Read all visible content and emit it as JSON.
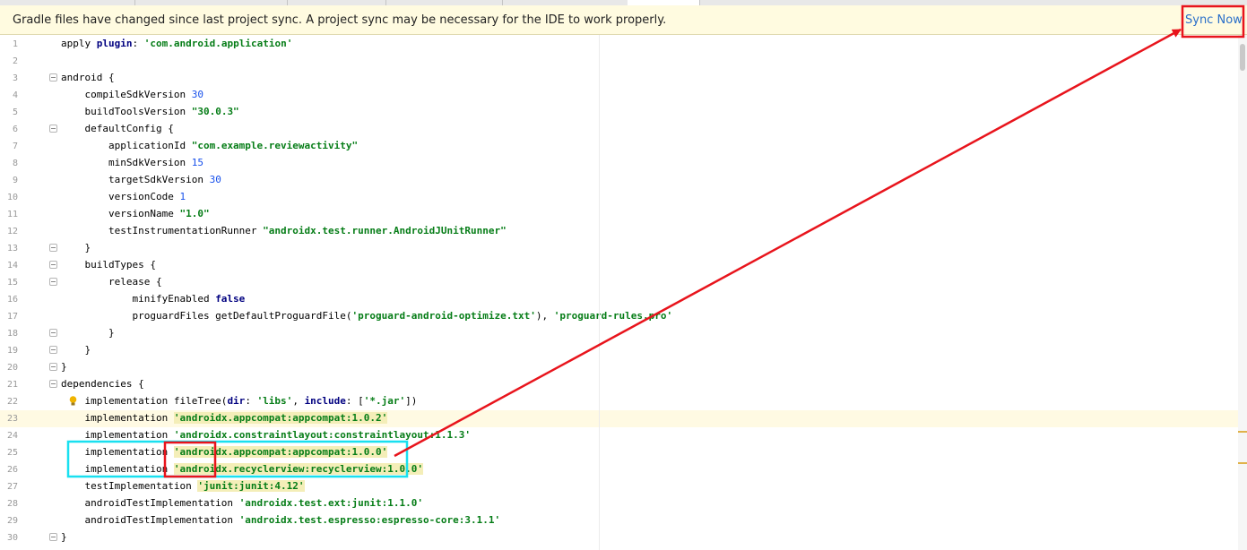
{
  "banner": {
    "message": "Gradle files have changed since last project sync. A project sync may be necessary for the IDE to work properly.",
    "action": "Sync Now"
  },
  "editor": {
    "lines": [
      {
        "n": "1",
        "fold": false,
        "tokens": [
          {
            "t": "apply "
          },
          {
            "t": "plugin",
            "c": "kw"
          },
          {
            "t": ": "
          },
          {
            "t": "'com.android.application'",
            "c": "str"
          }
        ]
      },
      {
        "n": "2",
        "fold": false,
        "tokens": []
      },
      {
        "n": "3",
        "fold": true,
        "tokens": [
          {
            "t": "android {"
          }
        ]
      },
      {
        "n": "4",
        "fold": false,
        "tokens": [
          {
            "t": "    compileSdkVersion "
          },
          {
            "t": "30",
            "c": "num"
          }
        ]
      },
      {
        "n": "5",
        "fold": false,
        "tokens": [
          {
            "t": "    buildToolsVersion "
          },
          {
            "t": "\"30.0.3\"",
            "c": "str"
          }
        ]
      },
      {
        "n": "6",
        "fold": true,
        "tokens": [
          {
            "t": "    defaultConfig {"
          }
        ]
      },
      {
        "n": "7",
        "fold": false,
        "tokens": [
          {
            "t": "        applicationId "
          },
          {
            "t": "\"com.example.reviewactivity\"",
            "c": "str"
          }
        ]
      },
      {
        "n": "8",
        "fold": false,
        "tokens": [
          {
            "t": "        minSdkVersion "
          },
          {
            "t": "15",
            "c": "num"
          }
        ]
      },
      {
        "n": "9",
        "fold": false,
        "tokens": [
          {
            "t": "        targetSdkVersion "
          },
          {
            "t": "30",
            "c": "num"
          }
        ]
      },
      {
        "n": "10",
        "fold": false,
        "tokens": [
          {
            "t": "        versionCode "
          },
          {
            "t": "1",
            "c": "num"
          }
        ]
      },
      {
        "n": "11",
        "fold": false,
        "tokens": [
          {
            "t": "        versionName "
          },
          {
            "t": "\"1.0\"",
            "c": "str"
          }
        ]
      },
      {
        "n": "12",
        "fold": false,
        "tokens": [
          {
            "t": "        testInstrumentationRunner "
          },
          {
            "t": "\"androidx.test.runner.AndroidJUnitRunner\"",
            "c": "str"
          }
        ]
      },
      {
        "n": "13",
        "fold": true,
        "tokens": [
          {
            "t": "    }"
          }
        ]
      },
      {
        "n": "14",
        "fold": true,
        "tokens": [
          {
            "t": "    buildTypes {"
          }
        ]
      },
      {
        "n": "15",
        "fold": true,
        "tokens": [
          {
            "t": "        release {"
          }
        ]
      },
      {
        "n": "16",
        "fold": false,
        "tokens": [
          {
            "t": "            minifyEnabled "
          },
          {
            "t": "false",
            "c": "kw"
          }
        ]
      },
      {
        "n": "17",
        "fold": false,
        "tokens": [
          {
            "t": "            proguardFiles getDefaultProguardFile("
          },
          {
            "t": "'proguard-android-optimize.txt'",
            "c": "str"
          },
          {
            "t": "), "
          },
          {
            "t": "'proguard-rules.pro'",
            "c": "str"
          }
        ]
      },
      {
        "n": "18",
        "fold": true,
        "tokens": [
          {
            "t": "        }"
          }
        ]
      },
      {
        "n": "19",
        "fold": true,
        "tokens": [
          {
            "t": "    }"
          }
        ]
      },
      {
        "n": "20",
        "fold": true,
        "tokens": [
          {
            "t": "}"
          }
        ]
      },
      {
        "n": "21",
        "fold": true,
        "tokens": [
          {
            "t": "dependencies {"
          }
        ]
      },
      {
        "n": "22",
        "fold": false,
        "bulb": true,
        "tokens": [
          {
            "t": "    implementation fileTree("
          },
          {
            "t": "dir",
            "c": "kw"
          },
          {
            "t": ": "
          },
          {
            "t": "'libs'",
            "c": "str"
          },
          {
            "t": ", "
          },
          {
            "t": "include",
            "c": "kw"
          },
          {
            "t": ": ["
          },
          {
            "t": "'*.jar'",
            "c": "str"
          },
          {
            "t": "])"
          }
        ]
      },
      {
        "n": "23",
        "fold": false,
        "current": true,
        "tokens": [
          {
            "t": "    implementation "
          },
          {
            "t": "'androidx.appcompat:appcompat:1.0.2'",
            "c": "str hl"
          }
        ]
      },
      {
        "n": "24",
        "fold": false,
        "tokens": [
          {
            "t": "    implementation "
          },
          {
            "t": "'androidx.constraintlayout:constraintlayout:1.1.3'",
            "c": "str"
          }
        ]
      },
      {
        "n": "25",
        "fold": false,
        "tokens": [
          {
            "t": "    implementation "
          },
          {
            "t": "'androidx.appcompat:appcompat:1.0.0'",
            "c": "str hl"
          }
        ]
      },
      {
        "n": "26",
        "fold": false,
        "tokens": [
          {
            "t": "    implementation "
          },
          {
            "t": "'androidx.recyclerview:recyclerview:1.0.0'",
            "c": "str hl"
          }
        ]
      },
      {
        "n": "27",
        "fold": false,
        "tokens": [
          {
            "t": "    testImplementation "
          },
          {
            "t": "'junit:junit:4.12'",
            "c": "str hl"
          }
        ]
      },
      {
        "n": "28",
        "fold": false,
        "tokens": [
          {
            "t": "    androidTestImplementation "
          },
          {
            "t": "'androidx.test.ext:junit:1.1.0'",
            "c": "str"
          }
        ]
      },
      {
        "n": "29",
        "fold": false,
        "tokens": [
          {
            "t": "    androidTestImplementation "
          },
          {
            "t": "'androidx.test.espresso:espresso-core:3.1.1'",
            "c": "str"
          }
        ]
      },
      {
        "n": "30",
        "fold": true,
        "tokens": [
          {
            "t": "}"
          }
        ]
      }
    ]
  },
  "colors": {
    "annotation_red": "#e8141c",
    "annotation_cyan": "#19e0f0",
    "banner_bg": "#fffbe0",
    "link": "#2a6fc9"
  },
  "icons": [
    "lightbulb-icon",
    "fold-marker-icon"
  ]
}
